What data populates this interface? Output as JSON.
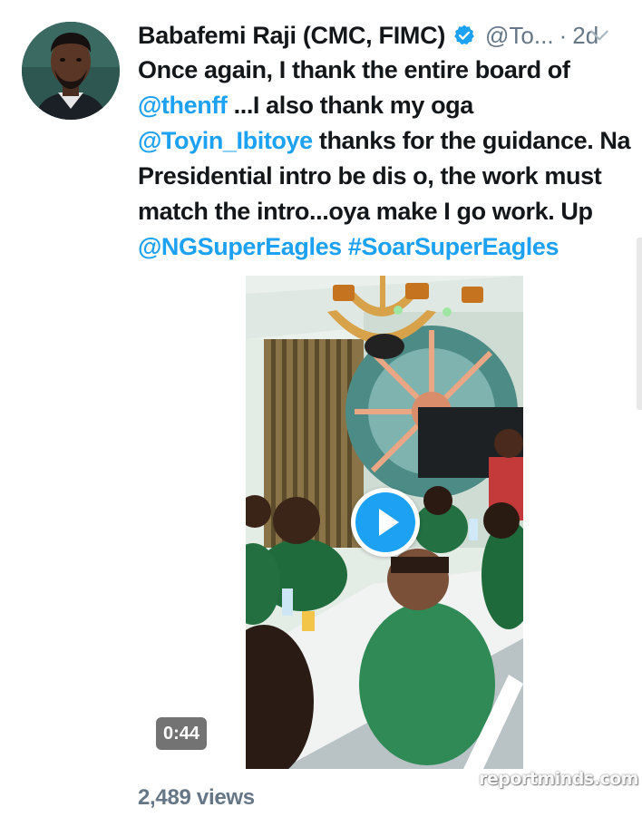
{
  "tweet": {
    "author_name": "Babafemi Raji (CMC, FIMC)",
    "handle": "@To...",
    "separator": "·",
    "age": "2d",
    "text_parts": [
      {
        "type": "text",
        "value": "Once again, I thank the entire board of "
      },
      {
        "type": "mention",
        "value": "@thenff"
      },
      {
        "type": "text",
        "value": " ...I also thank my oga "
      },
      {
        "type": "mention",
        "value": "@Toyin_Ibitoye"
      },
      {
        "type": "text",
        "value": " thanks for the guidance. Na Presidential intro be dis o, the work must match the intro...oya make I go work. Up "
      },
      {
        "type": "mention",
        "value": "@NGSuperEagles"
      },
      {
        "type": "text",
        "value": " "
      },
      {
        "type": "hashtag",
        "value": "#SoarSuperEagles"
      }
    ],
    "video_duration": "0:44",
    "views": "2,489 views"
  },
  "icons": {
    "verified": "verified-badge-icon",
    "menu": "chevron-down-icon",
    "play": "play-icon"
  },
  "colors": {
    "link": "#1da1f2",
    "text": "#14171a",
    "secondary": "#657786"
  },
  "watermark": "reportminds.com"
}
